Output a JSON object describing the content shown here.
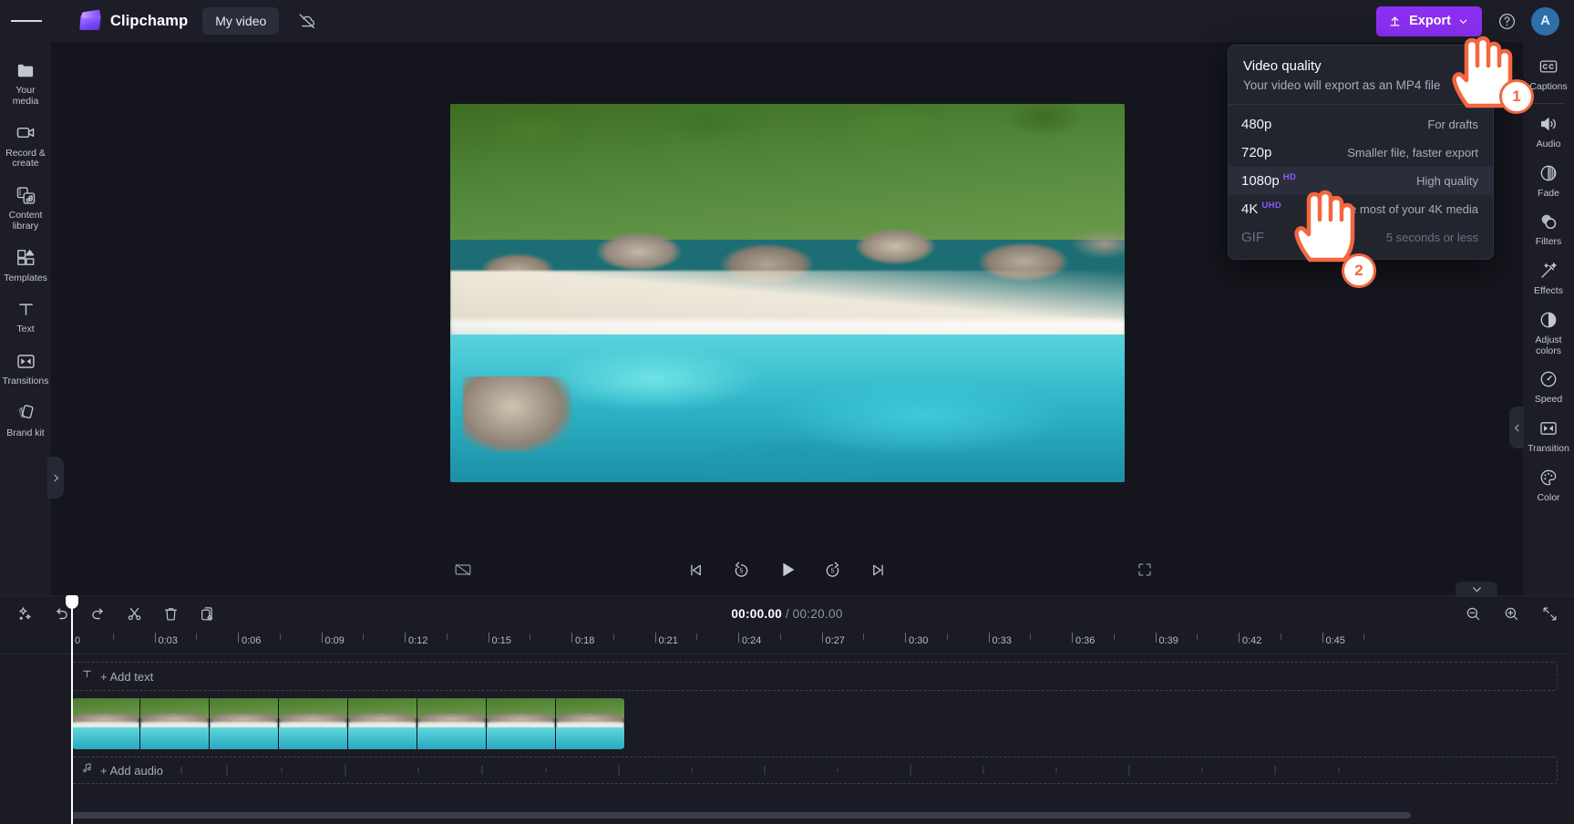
{
  "topbar": {
    "menu_icon": "hamburger-icon",
    "brand_name": "Clipchamp",
    "project_name": "My video",
    "cloud_icon": "cloud-off-icon",
    "export_label": "Export",
    "export_icon": "upload-arrow-icon",
    "export_chevron": "chevron-down-icon",
    "help_icon": "question-circle-icon",
    "avatar_initial": "A",
    "accent_color": "#8a2ff0",
    "avatar_color": "#2d6fa8"
  },
  "left_rail": {
    "items": [
      {
        "label": "Your media",
        "icon": "folder-icon"
      },
      {
        "label": "Record & create",
        "icon": "video-camera-icon"
      },
      {
        "label": "Content library",
        "icon": "content-library-icon"
      },
      {
        "label": "Templates",
        "icon": "templates-grid-icon"
      },
      {
        "label": "Text",
        "icon": "text-t-icon"
      },
      {
        "label": "Transitions",
        "icon": "transitions-icon"
      },
      {
        "label": "Brand kit",
        "icon": "brand-kit-icon"
      }
    ],
    "expand_icon": "chevron-right-icon"
  },
  "right_rail": {
    "items": [
      {
        "label": "Captions",
        "icon": "cc-icon"
      },
      {
        "label": "Audio",
        "icon": "speaker-icon"
      },
      {
        "label": "Fade",
        "icon": "fade-circle-icon"
      },
      {
        "label": "Filters",
        "icon": "filters-overlap-icon"
      },
      {
        "label": "Effects",
        "icon": "magic-wand-icon"
      },
      {
        "label": "Adjust colors",
        "icon": "half-circle-icon"
      },
      {
        "label": "Speed",
        "icon": "speedometer-icon"
      },
      {
        "label": "Transition",
        "icon": "transition-icon"
      },
      {
        "label": "Color",
        "icon": "palette-icon"
      }
    ],
    "collapse_icon": "chevron-left-icon"
  },
  "player": {
    "captions_icon": "captions-off-icon",
    "skip_back_icon": "skip-previous-icon",
    "rewind_icon": "rewind-5-icon",
    "play_icon": "play-icon",
    "forward_icon": "forward-5-icon",
    "skip_forward_icon": "skip-next-icon",
    "fullscreen_icon": "fullscreen-icon"
  },
  "timeline": {
    "tools": [
      {
        "name": "magic-ai-icon"
      },
      {
        "name": "undo-icon"
      },
      {
        "name": "redo-icon"
      },
      {
        "name": "split-scissors-icon"
      },
      {
        "name": "delete-trash-icon"
      },
      {
        "name": "duplicate-icon"
      }
    ],
    "current_time": "00:00.00",
    "separator": "/",
    "total_time": "00:20.00",
    "zoom_out_icon": "zoom-out-icon",
    "zoom_in_icon": "zoom-in-icon",
    "fit_icon": "fit-to-screen-icon",
    "hide_icon": "chevron-down-icon",
    "ruler_labels": [
      "0",
      "0:03",
      "0:06",
      "0:09",
      "0:12",
      "0:15",
      "0:18",
      "0:21",
      "0:24",
      "0:27",
      "0:30",
      "0:33",
      "0:36",
      "0:39",
      "0:42",
      "0:45"
    ],
    "add_text_label": "+ Add text",
    "add_text_icon": "text-t-icon",
    "add_audio_label": "+ Add audio",
    "add_audio_icon": "music-note-icon"
  },
  "export_dropdown": {
    "title": "Video quality",
    "subtitle": "Your video will export as an MP4 file",
    "options": [
      {
        "name": "480p",
        "badge": "",
        "desc": "For drafts",
        "selected": false,
        "disabled": false
      },
      {
        "name": "720p",
        "badge": "",
        "desc": "Smaller file, faster export",
        "selected": false,
        "disabled": false
      },
      {
        "name": "1080p",
        "badge": "HD",
        "desc": "High quality",
        "selected": true,
        "disabled": false
      },
      {
        "name": "4K",
        "badge": "UHD",
        "desc": "Make the most of your 4K media",
        "selected": false,
        "disabled": false
      },
      {
        "name": "GIF",
        "badge": "",
        "desc": "5 seconds or less",
        "selected": false,
        "disabled": true
      }
    ],
    "badge_color": "#8a5cff"
  },
  "annotations": {
    "step_one": "1",
    "step_two": "2",
    "cursor_icon": "pointing-hand-cursor",
    "highlight_color": "#f4663f"
  }
}
